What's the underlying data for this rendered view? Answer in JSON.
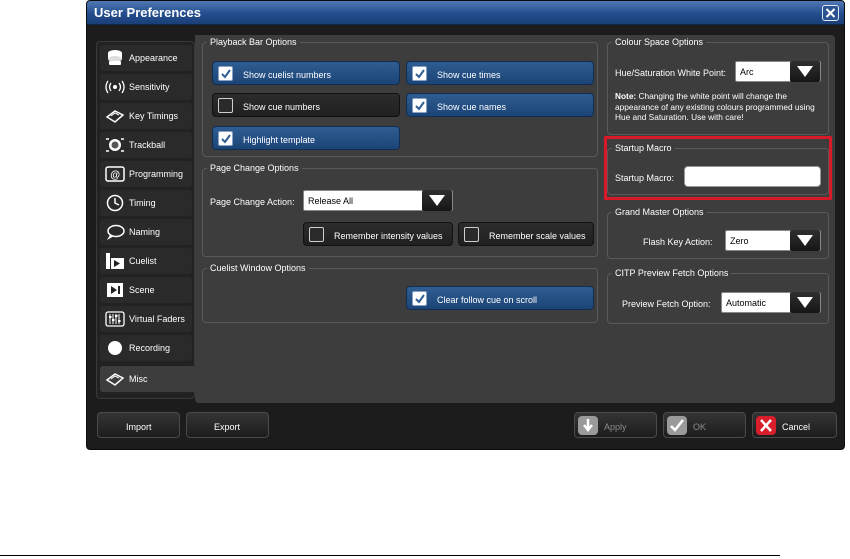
{
  "window": {
    "title": "User Preferences"
  },
  "sidebar": {
    "items": [
      {
        "label": "Appearance",
        "icon": "appearance-icon"
      },
      {
        "label": "Sensitivity",
        "icon": "sensitivity-icon"
      },
      {
        "label": "Key Timings",
        "icon": "key-timings-icon"
      },
      {
        "label": "Trackball",
        "icon": "trackball-icon"
      },
      {
        "label": "Programming",
        "icon": "programming-icon"
      },
      {
        "label": "Timing",
        "icon": "clock-icon"
      },
      {
        "label": "Naming",
        "icon": "speech-bubble-icon"
      },
      {
        "label": "Cuelist",
        "icon": "cuelist-icon"
      },
      {
        "label": "Scene",
        "icon": "scene-icon"
      },
      {
        "label": "Virtual Faders",
        "icon": "faders-icon"
      },
      {
        "label": "Recording",
        "icon": "record-icon"
      },
      {
        "label": "Misc",
        "icon": "misc-icon",
        "active": true
      }
    ]
  },
  "playback": {
    "legend": "Playback Bar Options",
    "show_cuelist_numbers": {
      "label": "Show cuelist numbers",
      "checked": true
    },
    "show_cue_times": {
      "label": "Show cue times",
      "checked": true
    },
    "show_cue_numbers": {
      "label": "Show cue numbers",
      "checked": false
    },
    "show_cue_names": {
      "label": "Show cue names",
      "checked": true
    },
    "highlight_template": {
      "label": "Highlight template",
      "checked": true
    }
  },
  "page_change": {
    "legend": "Page Change Options",
    "action_label": "Page Change Action:",
    "action_value": "Release All",
    "remember_intensity": {
      "label": "Remember intensity values",
      "checked": false
    },
    "remember_scale": {
      "label": "Remember scale values",
      "checked": false
    }
  },
  "cuelist_window": {
    "legend": "Cuelist Window Options",
    "clear_follow": {
      "label": "Clear follow cue on scroll",
      "checked": true
    }
  },
  "colour_space": {
    "legend": "Colour Space Options",
    "white_point_label": "Hue/Saturation White Point:",
    "white_point_value": "Arc",
    "note_bold": "Note:",
    "note_text": " Changing the white point will change the appearance of any existing colours programmed using Hue and Saturation. Use with care!"
  },
  "startup_macro": {
    "legend": "Startup Macro",
    "label": "Startup Macro:",
    "value": ""
  },
  "grand_master": {
    "legend": "Grand Master Options",
    "flash_label": "Flash Key Action:",
    "flash_value": "Zero"
  },
  "citp": {
    "legend": "CITP Preview Fetch Options",
    "fetch_label": "Preview Fetch Option:",
    "fetch_value": "Automatic"
  },
  "footer": {
    "import_label": "Import",
    "export_label": "Export",
    "apply_label": "Apply",
    "ok_label": "OK",
    "cancel_label": "Cancel"
  },
  "colors": {
    "accent_blue": "#2f5d92",
    "highlight_red": "#d8192a",
    "cancel_red": "#d81e2a"
  }
}
